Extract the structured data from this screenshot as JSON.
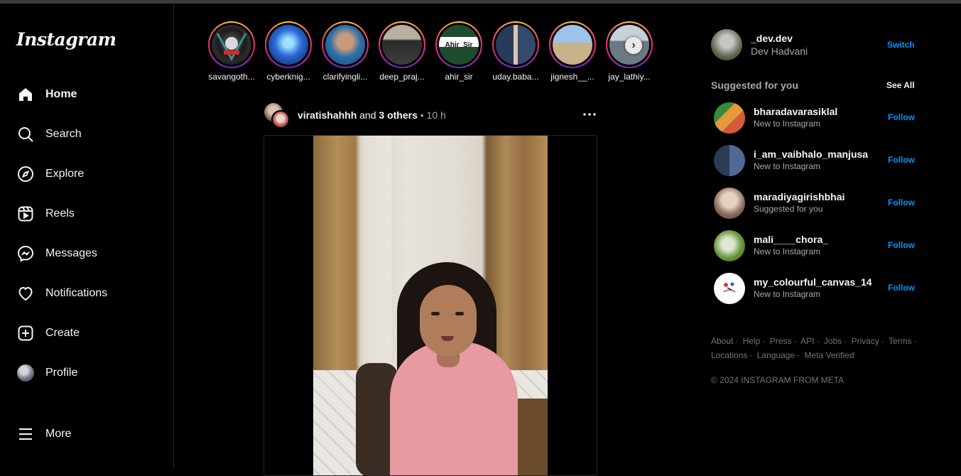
{
  "app": {
    "logo": "Instagram"
  },
  "sidebar": {
    "items": [
      {
        "label": "Home",
        "icon": "home-icon",
        "active": true
      },
      {
        "label": "Search",
        "icon": "search-icon"
      },
      {
        "label": "Explore",
        "icon": "compass-icon"
      },
      {
        "label": "Reels",
        "icon": "reels-icon"
      },
      {
        "label": "Messages",
        "icon": "messenger-icon"
      },
      {
        "label": "Notifications",
        "icon": "heart-icon"
      },
      {
        "label": "Create",
        "icon": "plus-square-icon"
      },
      {
        "label": "Profile",
        "icon": "avatar"
      }
    ],
    "more_label": "More"
  },
  "stories": [
    {
      "name": "savangoth..."
    },
    {
      "name": "cyberknig..."
    },
    {
      "name": "clarifyingli..."
    },
    {
      "name": "deep_praj..."
    },
    {
      "name": "ahir_sir",
      "pic_text": "Ahir_Sir"
    },
    {
      "name": "uday.baba..."
    },
    {
      "name": "jignesh__..."
    },
    {
      "name": "jay_lathiy..."
    }
  ],
  "post": {
    "username": "viratishahhh",
    "and_text": "and",
    "others": "3 others",
    "separator": "•",
    "time": "10 h"
  },
  "account": {
    "username": "_dev.dev",
    "name": "Dev Hadvani",
    "switch_label": "Switch"
  },
  "suggestions": {
    "title": "Suggested for you",
    "see_all": "See All",
    "follow_label": "Follow",
    "items": [
      {
        "username": "bharadavarasiklal",
        "sub": "New to Instagram"
      },
      {
        "username": "i_am_vaibhalo_manjusa",
        "sub": "New to Instagram"
      },
      {
        "username": "maradiyagirishbhai",
        "sub": "Suggested for you"
      },
      {
        "username": "mali____chora_",
        "sub": "New to Instagram"
      },
      {
        "username": "my_colourful_canvas_14",
        "sub": "New to Instagram"
      }
    ]
  },
  "footer": {
    "links": [
      "About",
      "Help",
      "Press",
      "API",
      "Jobs",
      "Privacy",
      "Terms",
      "Locations",
      "Language",
      "Meta Verified"
    ],
    "copyright": "© 2024 INSTAGRAM FROM META"
  },
  "colors": {
    "accent": "#0095f6",
    "background": "#000000",
    "muted": "#a8a8a8"
  }
}
